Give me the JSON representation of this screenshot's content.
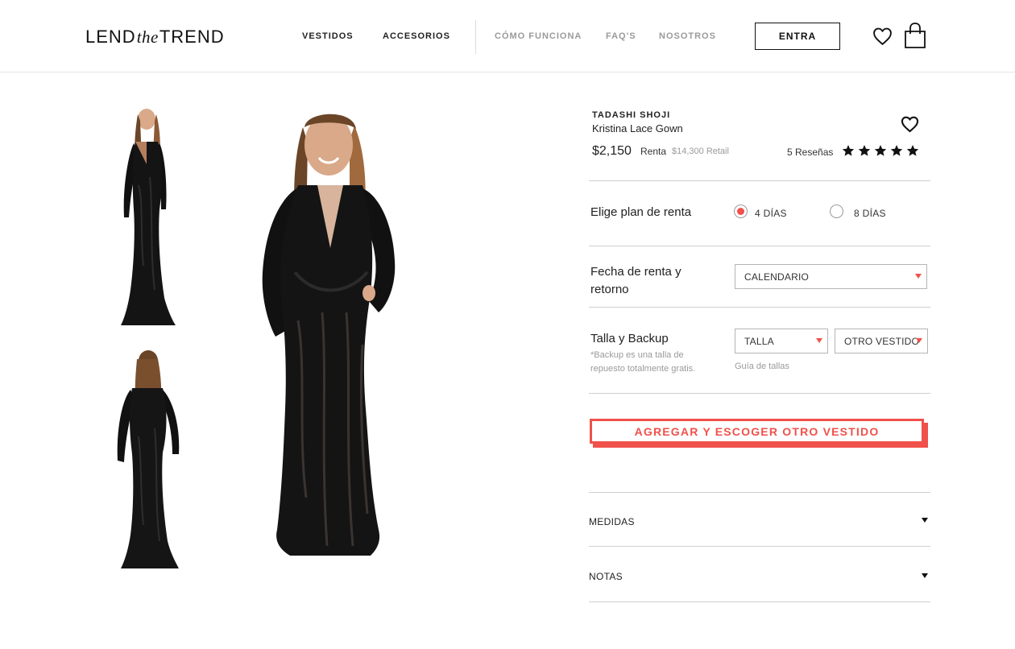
{
  "brand": {
    "lend": "LEND",
    "the": "the",
    "trend": "TREND"
  },
  "nav": {
    "items": [
      {
        "label": "VESTIDOS"
      },
      {
        "label": "ACCESORIOS"
      },
      {
        "label": "CÓMO FUNCIONA"
      },
      {
        "label": "FAQ'S"
      },
      {
        "label": "NOSOTROS"
      }
    ],
    "login_label": "ENTRA",
    "wishlist_icon": "heart-icon",
    "cart_icon": "shopping-bag-icon"
  },
  "product": {
    "designer": "TADASHI SHOJI",
    "name": "Kristina Lace Gown",
    "price": "$2,150",
    "price_label": "Renta",
    "retail": "$14,300 Retail",
    "reviews": "5 Reseñas",
    "rating": 5,
    "rating_max": 5
  },
  "rental_plan": {
    "label": "Elige plan de renta",
    "options": [
      {
        "label": "4 DÍAS",
        "selected": true
      },
      {
        "label": "8 DÍAS",
        "selected": false
      }
    ]
  },
  "dates": {
    "label_line1": "Fecha de renta y",
    "label_line2": "retorno",
    "select_value": "CALENDARIO"
  },
  "size": {
    "label": "Talla y Backup",
    "note_line1": "*Backup es una talla de",
    "note_line2": "repuesto totalmente gratis.",
    "size_select": "TALLA",
    "backup_select": "OTRO VESTIDO",
    "guide_link": "Guía de tallas"
  },
  "cta": {
    "label": "AGREGAR Y ESCOGER OTRO VESTIDO"
  },
  "accordions": [
    {
      "label": "MEDIDAS"
    },
    {
      "label": "NOTAS"
    }
  ],
  "colors": {
    "accent": "#f0514b",
    "text": "#222222",
    "muted": "#9a9a9a",
    "divider": "#cfcfcf"
  }
}
